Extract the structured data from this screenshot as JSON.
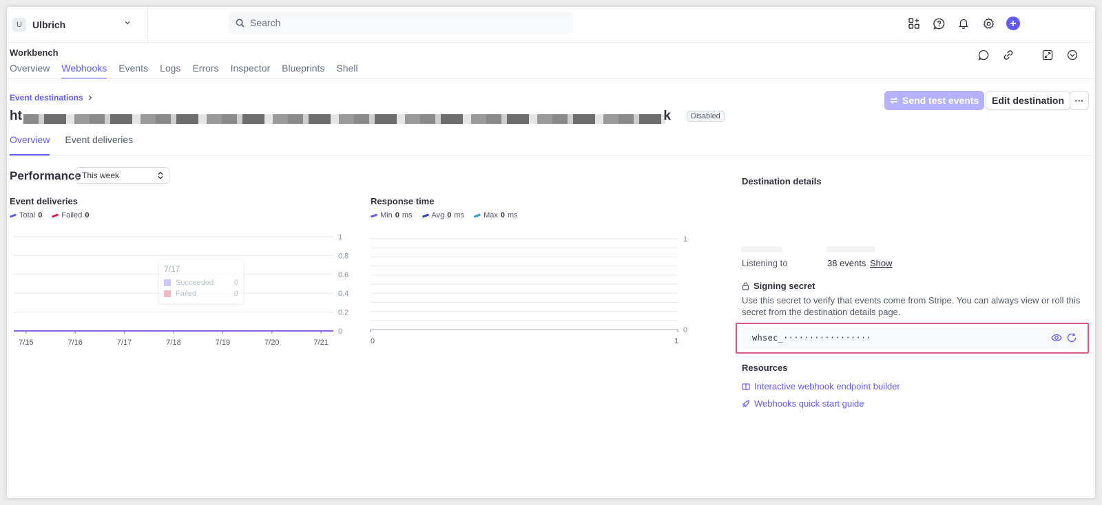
{
  "account": {
    "initial": "U",
    "name": "Ulbrich"
  },
  "search": {
    "placeholder": "Search"
  },
  "workbench": {
    "title": "Workbench",
    "tabs": [
      "Overview",
      "Webhooks",
      "Events",
      "Logs",
      "Errors",
      "Inspector",
      "Blueprints",
      "Shell"
    ],
    "active_tab": "Webhooks"
  },
  "destination": {
    "breadcrumb": "Event destinations",
    "url_start": "ht",
    "url_end": "k",
    "status": "Disabled",
    "send_test_label": "Send test events",
    "edit_label": "Edit destination",
    "more_label": "···"
  },
  "sub_tabs": [
    "Overview",
    "Event deliveries"
  ],
  "performance": {
    "title": "Performance",
    "range": "This week"
  },
  "charts": {
    "deliveries": {
      "title": "Event deliveries",
      "legend": [
        {
          "name": "Total",
          "value": "0",
          "color": "#635bff"
        },
        {
          "name": "Failed",
          "value": "0",
          "color": "#df1b41"
        }
      ]
    },
    "response": {
      "title": "Response time",
      "legend": [
        {
          "name": "Min",
          "value": "0",
          "unit": "ms",
          "color": "#635bff"
        },
        {
          "name": "Avg",
          "value": "0",
          "unit": "ms",
          "color": "#2744c4"
        },
        {
          "name": "Max",
          "value": "0",
          "unit": "ms",
          "color": "#3a9bc4"
        }
      ]
    },
    "tooltip": {
      "date": "7/17",
      "rows": [
        {
          "label": "Succeeded",
          "value": "0",
          "color": "#b8b5ff"
        },
        {
          "label": "Failed",
          "value": "0",
          "color": "#f2a3a8"
        }
      ]
    }
  },
  "chart_data": [
    {
      "type": "line",
      "title": "Event deliveries",
      "x": [
        "7/15",
        "7/16",
        "7/17",
        "7/18",
        "7/19",
        "7/20",
        "7/21"
      ],
      "series": [
        {
          "name": "Total",
          "values": [
            0,
            0,
            0,
            0,
            0,
            0,
            0
          ]
        },
        {
          "name": "Failed",
          "values": [
            0,
            0,
            0,
            0,
            0,
            0,
            0
          ]
        }
      ],
      "yticks": [
        "0",
        "0.2",
        "0.4",
        "0.6",
        "0.8",
        "1"
      ],
      "ylim": [
        0,
        1
      ],
      "grid": true
    },
    {
      "type": "line",
      "title": "Response time",
      "xticks": [
        "0",
        "1"
      ],
      "xlim": [
        0,
        1
      ],
      "series": [
        {
          "name": "Min",
          "values": []
        },
        {
          "name": "Avg",
          "values": []
        },
        {
          "name": "Max",
          "values": []
        }
      ],
      "yticks": [
        "0",
        "1"
      ],
      "ylim": [
        0,
        1
      ],
      "grid": true
    }
  ],
  "details": {
    "title": "Destination details",
    "listening_label": "Listening to",
    "listening_value": "38 events",
    "show_label": "Show",
    "signing_title": "Signing secret",
    "signing_desc": "Use this secret to verify that events come from Stripe. You can always view or roll this secret from the destination details page.",
    "secret_value": "whsec_·················",
    "resources_title": "Resources",
    "resources": [
      "Interactive webhook endpoint builder",
      "Webhooks quick start guide"
    ]
  }
}
